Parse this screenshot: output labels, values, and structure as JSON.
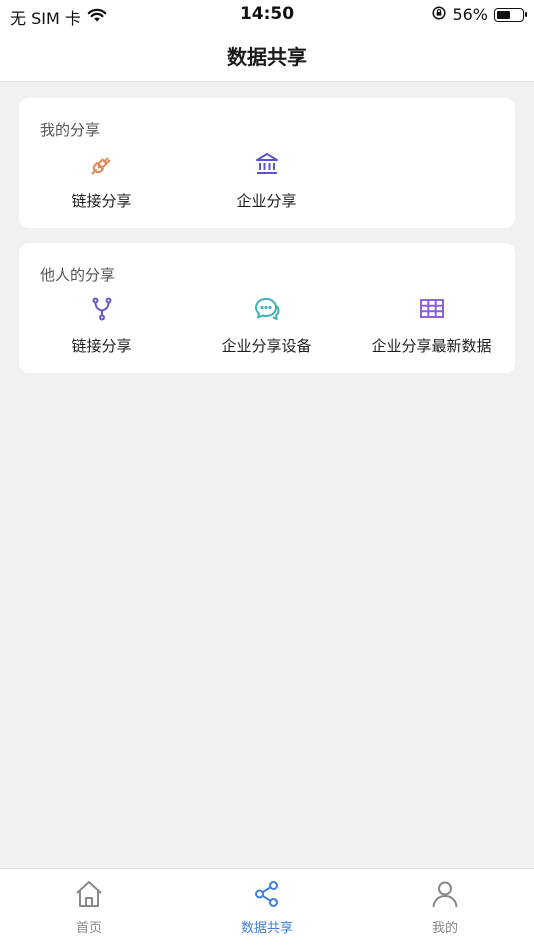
{
  "status_bar": {
    "carrier": "无 SIM 卡",
    "time": "14:50",
    "battery_percent": "56%",
    "battery_level": 0.56
  },
  "header": {
    "title": "数据共享"
  },
  "sections": [
    {
      "title": "我的分享",
      "items": [
        {
          "label": "链接分享",
          "icon": "plug-icon",
          "color": "#e08a5a"
        },
        {
          "label": "企业分享",
          "icon": "bank-icon",
          "color": "#5b55c9"
        }
      ]
    },
    {
      "title": "他人的分享",
      "items": [
        {
          "label": "链接分享",
          "icon": "branch-icon",
          "color": "#6b57c8"
        },
        {
          "label": "企业分享设备",
          "icon": "chat-bubble-icon",
          "color": "#3fb3b3"
        },
        {
          "label": "企业分享最新数据",
          "icon": "table-grid-icon",
          "color": "#8a64d6"
        }
      ]
    }
  ],
  "tab_bar": {
    "tabs": [
      {
        "label": "首页",
        "icon": "home-icon"
      },
      {
        "label": "数据共享",
        "icon": "share-icon",
        "active": true
      },
      {
        "label": "我的",
        "icon": "user-icon"
      }
    ],
    "active_color": "#3f7fd9",
    "inactive_color": "#888888"
  }
}
